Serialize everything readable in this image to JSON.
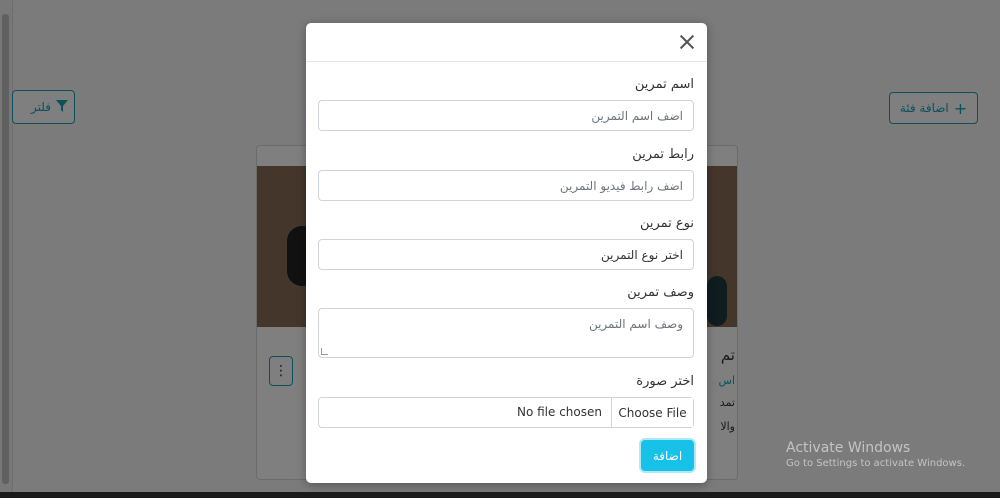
{
  "background": {
    "add_category_label": "اضافة فئة",
    "filter_label": "فلتر",
    "card": {
      "title": "تم",
      "subtitle": "اس",
      "line1": "تمد",
      "line2": "والا"
    }
  },
  "modal": {
    "fields": [
      {
        "label": "اسم تمرين",
        "placeholder": "اضف اسم التمرين"
      },
      {
        "label": "رابط تمرين",
        "placeholder": "اضف رابط فيديو التمرين"
      },
      {
        "label": "نوع تمرين",
        "value": "اختر نوع التمرين"
      },
      {
        "label": "وصف تمرين",
        "placeholder": "وصف اسم التمرين"
      }
    ],
    "image_label": "اختر صورة",
    "file_button": "Choose File",
    "file_status": "No file chosen",
    "submit_label": "اضافة"
  },
  "watermark": {
    "title": "Activate Windows",
    "subtitle": "Go to Settings to activate Windows."
  },
  "colors": {
    "accent": "#17a2b8",
    "submit": "#17c1e8",
    "overlay": "rgba(0,0,0,0.5)"
  }
}
